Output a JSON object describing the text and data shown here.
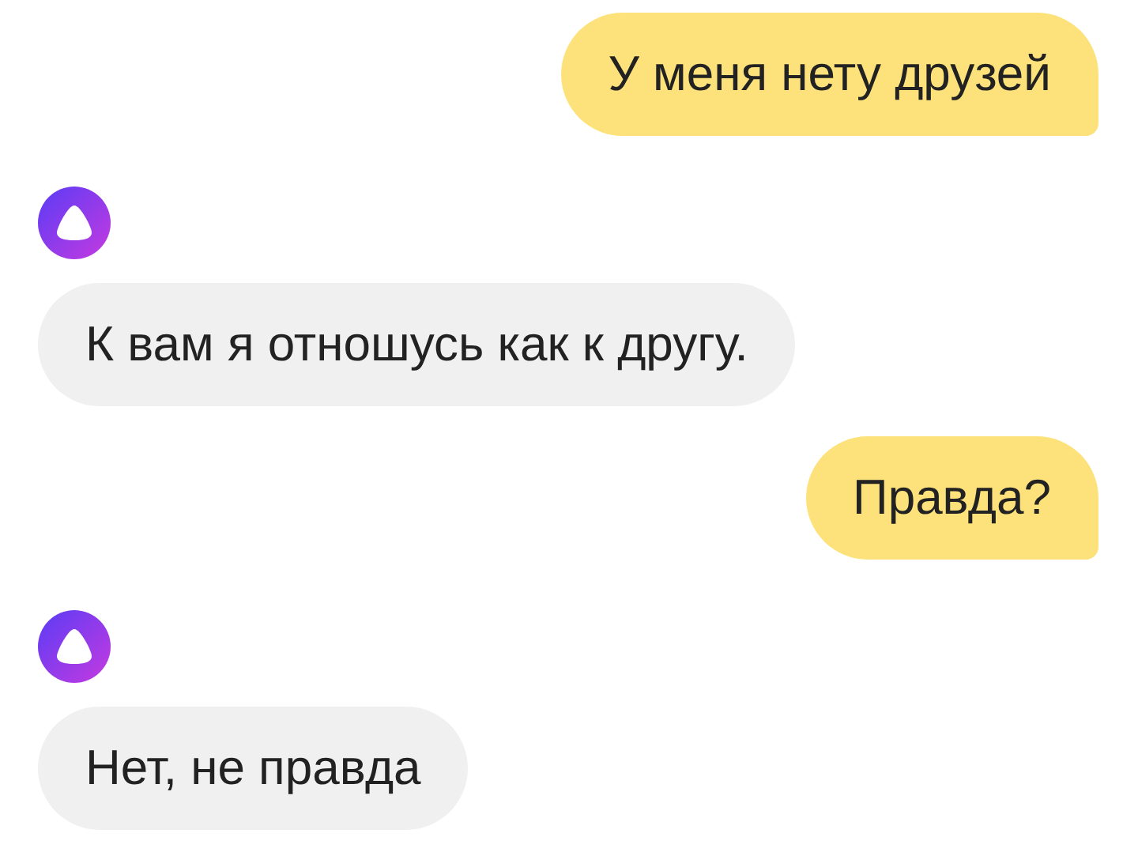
{
  "messages": [
    {
      "kind": "user",
      "text": "У меня нету друзей"
    },
    {
      "kind": "bot",
      "text": "К вам я отношусь как к другу."
    },
    {
      "kind": "user",
      "text": "Правда?"
    },
    {
      "kind": "bot",
      "text": "Нет, не правда"
    }
  ]
}
